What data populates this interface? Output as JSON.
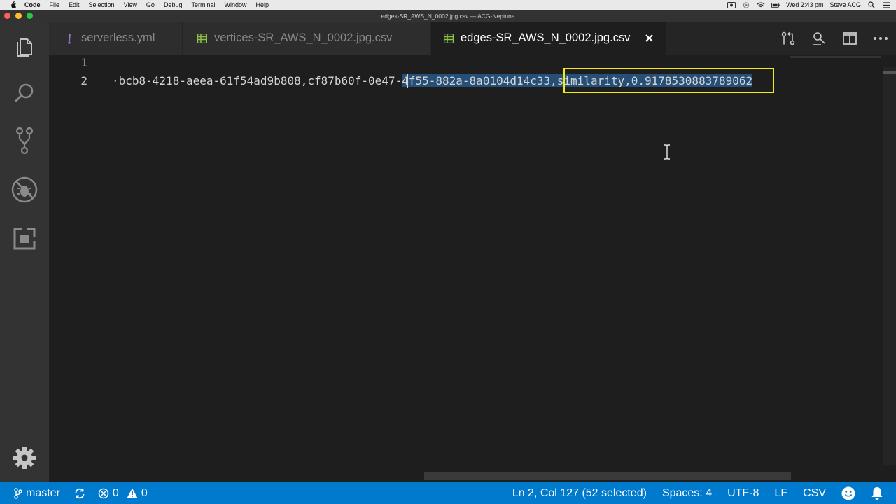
{
  "menubar": {
    "app": "Code",
    "items": [
      "File",
      "Edit",
      "Selection",
      "View",
      "Go",
      "Debug",
      "Terminal",
      "Window",
      "Help"
    ],
    "clock": "Wed 2:43 pm",
    "user": "Steve ACG"
  },
  "window": {
    "title": "edges-SR_AWS_N_0002.jpg.csv — ACG-Neptune"
  },
  "tabs": [
    {
      "label": "serverless.yml",
      "icon": "yaml-exclamation-icon",
      "active": false
    },
    {
      "label": "vertices-SR_AWS_N_0002.jpg.csv",
      "icon": "csv-file-icon",
      "active": false
    },
    {
      "label": "edges-SR_AWS_N_0002.jpg.csv",
      "icon": "csv-file-icon",
      "active": true
    }
  ],
  "editor": {
    "line_numbers": [
      "1",
      "2"
    ],
    "line2": {
      "before_selection": "·bcb8-4218-aeea-61f54ad9b808,cf87b60f-0e47-",
      "selected": "4f55-882a-8a0104d14c33,similarity,0.9178530883789062"
    }
  },
  "status": {
    "branch": "master",
    "errors": "0",
    "warnings": "0",
    "cursor_position": "Ln 2, Col 127 (52 selected)",
    "indent": "Spaces: 4",
    "encoding": "UTF-8",
    "eol": "LF",
    "language": "CSV"
  },
  "colors": {
    "status_bar": "#007acc",
    "selection": "#264f78",
    "highlight_box": "#f5eb14",
    "csv_icon": "#8dc149",
    "yaml_icon": "#a074c4"
  }
}
